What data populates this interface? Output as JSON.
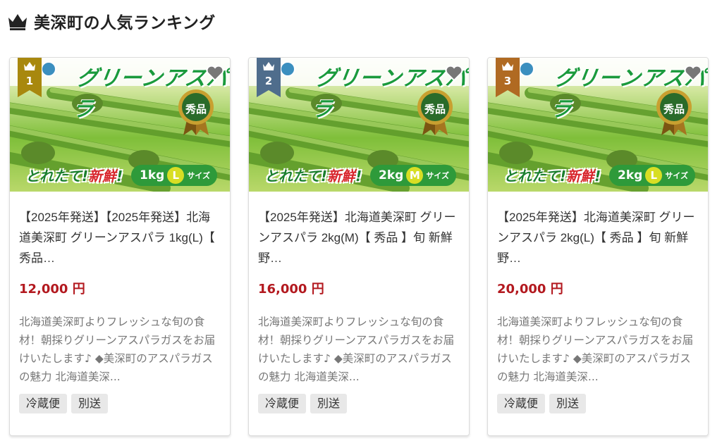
{
  "section": {
    "title": "美深町の人気ランキング",
    "icon": "crown-icon"
  },
  "colors": {
    "gold": "#a8880e",
    "silver": "#4f6d8c",
    "bronze": "#b06a22",
    "price": "#b3191f",
    "green": "#1a9a3c"
  },
  "products": [
    {
      "rank": "1",
      "image": {
        "heading": "グリーンアスパラ",
        "seal": "秀品",
        "fresh_1": "とれたて",
        "fresh_sep": "!",
        "fresh_2": "新鮮",
        "fresh_3": "!",
        "weight": "1kg",
        "size": "L",
        "size_label": "サイズ"
      },
      "name": "【2025年発送】【2025年発送】北海道美深町 グリーンアスパラ 1kg(L)【 秀品…",
      "price": "12,000 円",
      "description": "北海道美深町よりフレッシュな旬の食材！朝採りグリーンアスパラガスをお届けいたします♪ ◆美深町のアスパラガスの魅力 北海道美深...",
      "tags": [
        "冷蔵便",
        "別送"
      ]
    },
    {
      "rank": "2",
      "image": {
        "heading": "グリーンアスパラ",
        "seal": "秀品",
        "fresh_1": "とれたて",
        "fresh_sep": "!",
        "fresh_2": "新鮮",
        "fresh_3": "!",
        "weight": "2kg",
        "size": "M",
        "size_label": "サイズ"
      },
      "name": "【2025年発送】北海道美深町 グリーンアスパラ 2kg(M)【 秀品 】旬 新鮮 野…",
      "price": "16,000 円",
      "description": "北海道美深町よりフレッシュな旬の食材！朝採りグリーンアスパラガスをお届けいたします♪ ◆美深町のアスパラガスの魅力 北海道美深...",
      "tags": [
        "冷蔵便",
        "別送"
      ]
    },
    {
      "rank": "3",
      "image": {
        "heading": "グリーンアスパラ",
        "seal": "秀品",
        "fresh_1": "とれたて",
        "fresh_sep": "!",
        "fresh_2": "新鮮",
        "fresh_3": "!",
        "weight": "2kg",
        "size": "L",
        "size_label": "サイズ"
      },
      "name": "【2025年発送】北海道美深町 グリーンアスパラ 2kg(L)【 秀品 】旬 新鮮 野…",
      "price": "20,000 円",
      "description": "北海道美深町よりフレッシュな旬の食材！朝採りグリーンアスパラガスをお届けいたします♪ ◆美深町のアスパラガスの魅力 北海道美深...",
      "tags": [
        "冷蔵便",
        "別送"
      ]
    }
  ]
}
